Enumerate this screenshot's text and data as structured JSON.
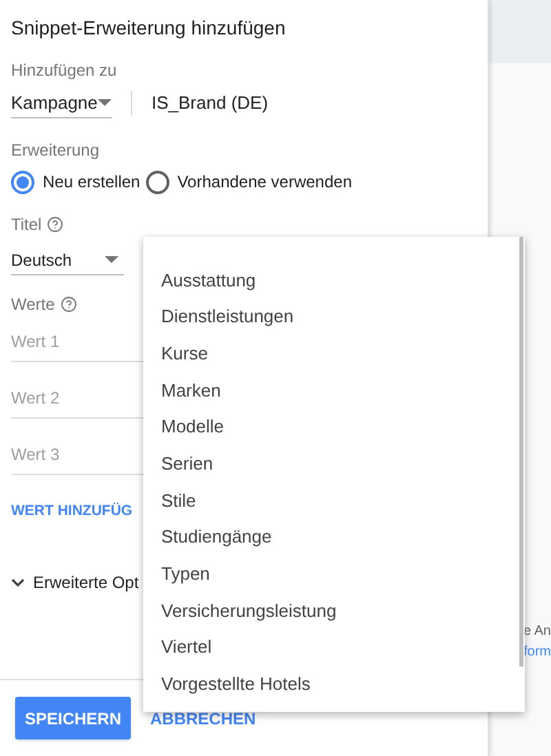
{
  "dialog": {
    "title": "Snippet-Erweiterung hinzufügen",
    "add_to": {
      "label": "Hinzufügen zu",
      "level_select": {
        "value": "Kampagne"
      },
      "campaign": "IS_Brand (DE)"
    },
    "extension": {
      "label": "Erweiterung",
      "options": [
        {
          "label": "Neu erstellen",
          "selected": true
        },
        {
          "label": "Vorhandene verwenden",
          "selected": false
        }
      ]
    },
    "title_field": {
      "label": "Titel",
      "value": "Deutsch"
    },
    "values": {
      "label": "Werte",
      "fields": [
        {
          "placeholder": "Wert 1"
        },
        {
          "placeholder": "Wert 2"
        },
        {
          "placeholder": "Wert 3"
        }
      ],
      "add_link": "WERT HINZUFÜG"
    },
    "advanced": {
      "label": "Erweiterte Opt",
      "expanded": false
    },
    "buttons": {
      "save": "SPEICHERN",
      "cancel": "ABBRECHEN"
    }
  },
  "background": {
    "texts": [
      {
        "text": "e An",
        "kind": "plain"
      },
      {
        "text": "form",
        "kind": "link"
      }
    ]
  },
  "menu": {
    "items": [
      {
        "label": "Ausstattung"
      },
      {
        "label": "Dienstleistungen"
      },
      {
        "label": "Kurse"
      },
      {
        "label": "Marken"
      },
      {
        "label": "Modelle"
      },
      {
        "label": "Serien"
      },
      {
        "label": "Stile"
      },
      {
        "label": "Studiengänge"
      },
      {
        "label": "Typen"
      },
      {
        "label": "Versicherungsleistung"
      },
      {
        "label": "Viertel"
      },
      {
        "label": "Vorgestellte Hotels"
      }
    ]
  }
}
